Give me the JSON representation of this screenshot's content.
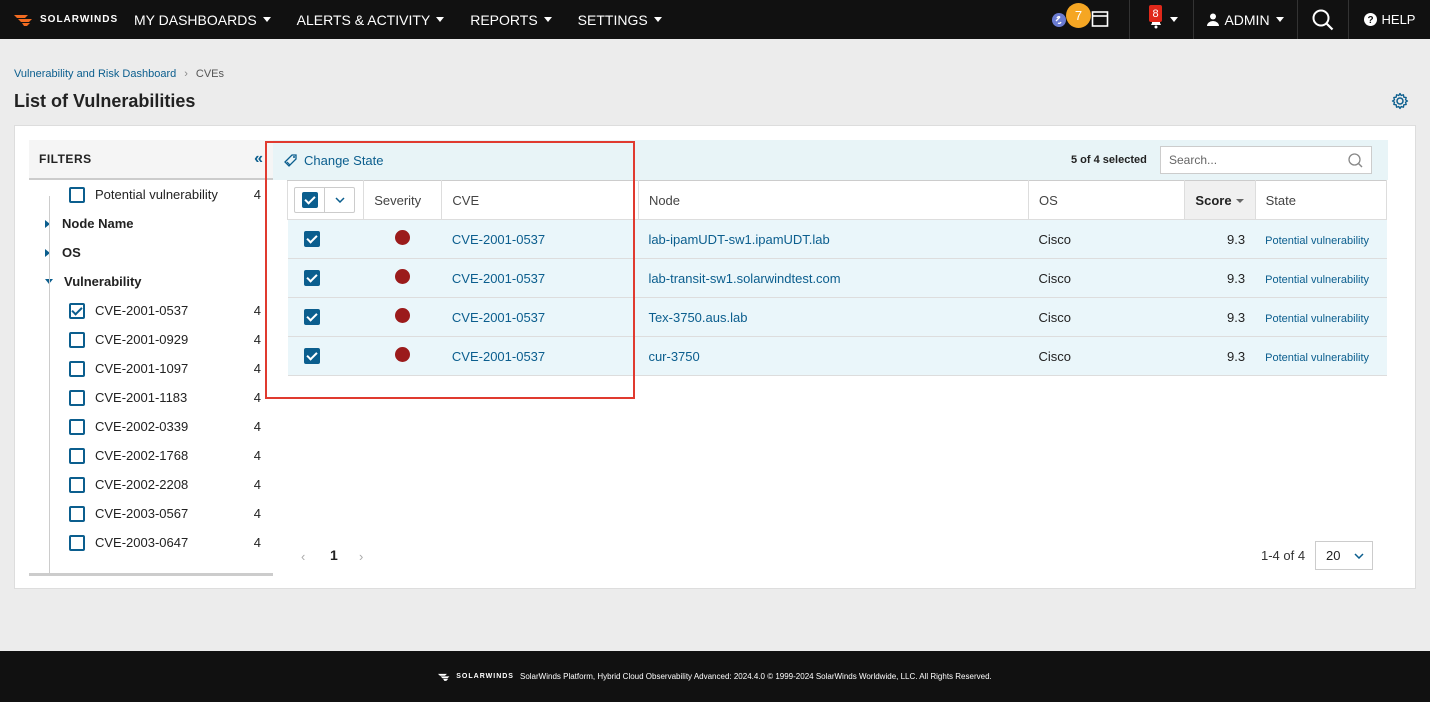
{
  "nav": {
    "brand": "SOLARWINDS",
    "menu": [
      {
        "label": "MY DASHBOARDS"
      },
      {
        "label": "ALERTS & ACTIVITY"
      },
      {
        "label": "REPORTS"
      },
      {
        "label": "SETTINGS"
      }
    ],
    "notif_count": "7",
    "alert_count": "8",
    "user_label": "ADMIN",
    "help_label": "HELP"
  },
  "breadcrumb": {
    "parent": "Vulnerability and Risk Dashboard",
    "current": "CVEs"
  },
  "page_title": "List of Vulnerabilities",
  "filters": {
    "title": "FILTERS",
    "top_item": {
      "label": "Potential vulnerability",
      "count": "4"
    },
    "groups": [
      {
        "label": "Node Name"
      },
      {
        "label": "OS"
      },
      {
        "label": "Vulnerability"
      }
    ],
    "vuln_items": [
      {
        "label": "CVE-2001-0537",
        "count": "4",
        "checked": true
      },
      {
        "label": "CVE-2001-0929",
        "count": "4",
        "checked": false
      },
      {
        "label": "CVE-2001-1097",
        "count": "4",
        "checked": false
      },
      {
        "label": "CVE-2001-1183",
        "count": "4",
        "checked": false
      },
      {
        "label": "CVE-2002-0339",
        "count": "4",
        "checked": false
      },
      {
        "label": "CVE-2002-1768",
        "count": "4",
        "checked": false
      },
      {
        "label": "CVE-2002-2208",
        "count": "4",
        "checked": false
      },
      {
        "label": "CVE-2003-0567",
        "count": "4",
        "checked": false
      },
      {
        "label": "CVE-2003-0647",
        "count": "4",
        "checked": false
      }
    ]
  },
  "toolbar": {
    "change_state_label": "Change State",
    "selected_text": "5 of 4 selected",
    "search_placeholder": "Search..."
  },
  "table": {
    "columns": [
      "Severity",
      "CVE",
      "Node",
      "OS",
      "Score",
      "State"
    ],
    "rows": [
      {
        "cve": "CVE-2001-0537",
        "node": "lab-ipamUDT-sw1.ipamUDT.lab",
        "os": "Cisco",
        "score": "9.3",
        "state": "Potential vulnerability"
      },
      {
        "cve": "CVE-2001-0537",
        "node": "lab-transit-sw1.solarwindtest.com",
        "os": "Cisco",
        "score": "9.3",
        "state": "Potential vulnerability"
      },
      {
        "cve": "CVE-2001-0537",
        "node": "Tex-3750.aus.lab",
        "os": "Cisco",
        "score": "9.3",
        "state": "Potential vulnerability"
      },
      {
        "cve": "CVE-2001-0537",
        "node": "cur-3750",
        "os": "Cisco",
        "score": "9.3",
        "state": "Potential vulnerability"
      }
    ]
  },
  "pager": {
    "current_page": "1",
    "range_text": "1-4 of 4",
    "page_size": "20"
  },
  "footer": {
    "brand": "SOLARWINDS",
    "text": "SolarWinds Platform, Hybrid Cloud Observability Advanced: 2024.4.0 © 1999-2024 SolarWinds Worldwide, LLC. All Rights Reserved."
  },
  "colors": {
    "accent": "#0b5e8e",
    "severity_critical": "#9b1b1b",
    "highlight": "#e03a2f",
    "nav_bg": "#111111"
  }
}
